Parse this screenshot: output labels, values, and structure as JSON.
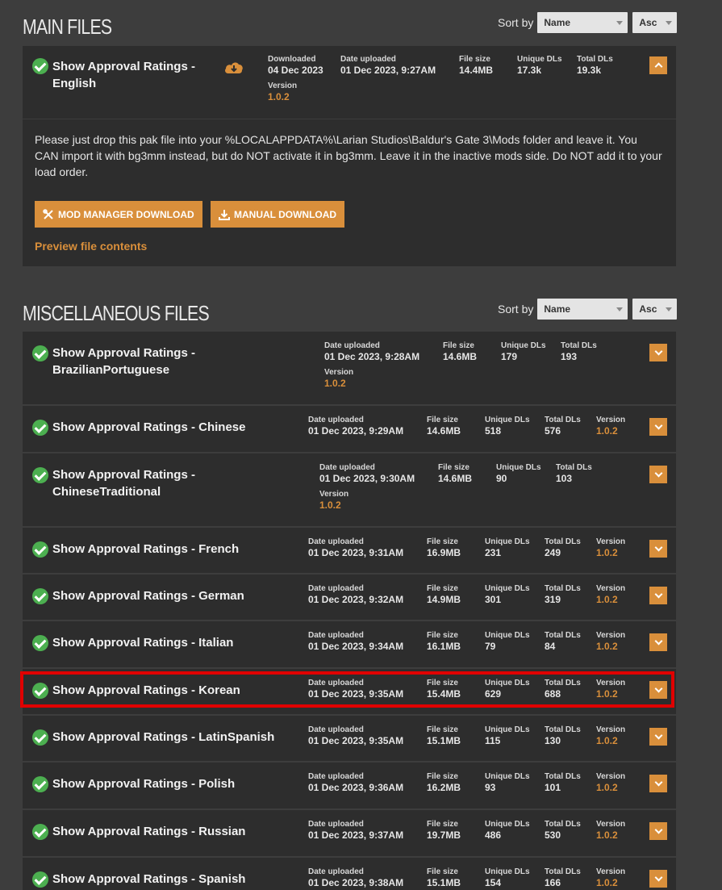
{
  "main": {
    "title": "MAIN FILES",
    "sort_label": "Sort by",
    "sort_field": "Name",
    "sort_order": "Asc",
    "file": {
      "name_line1": "Show Approval Ratings -",
      "name_line2": "English",
      "downloaded_label": "Downloaded",
      "downloaded": "04 Dec 2023",
      "uploaded_label": "Date uploaded",
      "uploaded": "01 Dec 2023, 9:27AM",
      "size_label": "File size",
      "size": "14.4MB",
      "unique_label": "Unique DLs",
      "unique": "17.3k",
      "total_label": "Total DLs",
      "total": "19.3k",
      "version_label": "Version",
      "version": "1.0.2"
    },
    "description": "Please just drop this pak file into your %LOCALAPPDATA%\\Larian Studios\\Baldur's Gate 3\\Mods folder and leave it. You CAN import it with bg3mm instead, but do NOT activate it in bg3mm. Leave it in the inactive mods side. Do NOT add it to your load order.",
    "mod_manager_label": "MOD MANAGER DOWNLOAD",
    "manual_label": "MANUAL DOWNLOAD",
    "preview_label": "Preview file contents"
  },
  "misc": {
    "title": "MISCELLANEOUS FILES",
    "sort_label": "Sort by",
    "sort_field": "Name",
    "sort_order": "Asc",
    "labels": {
      "uploaded": "Date uploaded",
      "size": "File size",
      "unique": "Unique DLs",
      "total": "Total DLs",
      "version": "Version"
    },
    "files": [
      {
        "name_line1": "Show Approval Ratings -",
        "name_line2": "BrazilianPortuguese",
        "uploaded": "01 Dec 2023, 9:28AM",
        "size": "14.6MB",
        "unique": "179",
        "total": "193",
        "version": "1.0.2"
      },
      {
        "name_line1": "Show Approval Ratings - Chinese",
        "uploaded": "01 Dec 2023, 9:29AM",
        "size": "14.6MB",
        "unique": "518",
        "total": "576",
        "version": "1.0.2"
      },
      {
        "name_line1": "Show Approval Ratings -",
        "name_line2": "ChineseTraditional",
        "uploaded": "01 Dec 2023, 9:30AM",
        "size": "14.6MB",
        "unique": "90",
        "total": "103",
        "version": "1.0.2"
      },
      {
        "name_line1": "Show Approval Ratings - French",
        "uploaded": "01 Dec 2023, 9:31AM",
        "size": "16.9MB",
        "unique": "231",
        "total": "249",
        "version": "1.0.2"
      },
      {
        "name_line1": "Show Approval Ratings - German",
        "uploaded": "01 Dec 2023, 9:32AM",
        "size": "14.9MB",
        "unique": "301",
        "total": "319",
        "version": "1.0.2"
      },
      {
        "name_line1": "Show Approval Ratings - Italian",
        "uploaded": "01 Dec 2023, 9:34AM",
        "size": "16.1MB",
        "unique": "79",
        "total": "84",
        "version": "1.0.2"
      },
      {
        "name_line1": "Show Approval Ratings - Korean",
        "uploaded": "01 Dec 2023, 9:35AM",
        "size": "15.4MB",
        "unique": "629",
        "total": "688",
        "version": "1.0.2"
      },
      {
        "name_line1": "Show Approval Ratings - LatinSpanish",
        "uploaded": "01 Dec 2023, 9:35AM",
        "size": "15.1MB",
        "unique": "115",
        "total": "130",
        "version": "1.0.2"
      },
      {
        "name_line1": "Show Approval Ratings - Polish",
        "uploaded": "01 Dec 2023, 9:36AM",
        "size": "16.2MB",
        "unique": "93",
        "total": "101",
        "version": "1.0.2"
      },
      {
        "name_line1": "Show Approval Ratings - Russian",
        "uploaded": "01 Dec 2023, 9:37AM",
        "size": "19.7MB",
        "unique": "486",
        "total": "530",
        "version": "1.0.2"
      },
      {
        "name_line1": "Show Approval Ratings - Spanish",
        "uploaded": "01 Dec 2023, 9:38AM",
        "size": "15.1MB",
        "unique": "154",
        "total": "166",
        "version": "1.0.2"
      }
    ]
  }
}
